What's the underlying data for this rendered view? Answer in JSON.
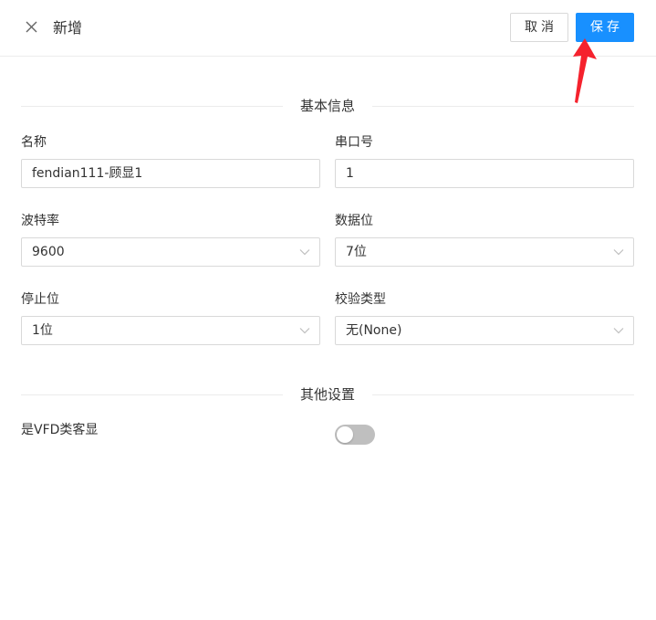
{
  "header": {
    "title": "新增",
    "cancel_label": "取消",
    "save_label": "保存"
  },
  "sections": {
    "basic": "基本信息",
    "other": "其他设置"
  },
  "fields": {
    "name": {
      "label": "名称",
      "value": "fendian111-顾显1"
    },
    "serial_port": {
      "label": "串口号",
      "value": "1"
    },
    "baud_rate": {
      "label": "波特率",
      "value": "9600"
    },
    "data_bits": {
      "label": "数据位",
      "value": "7位"
    },
    "stop_bits": {
      "label": "停止位",
      "value": "1位"
    },
    "parity": {
      "label": "校验类型",
      "value": "无(None)"
    },
    "vfd_display": {
      "label": "是VFD类客显",
      "enabled": false
    }
  },
  "colors": {
    "primary": "#1890ff",
    "annotation_arrow": "#f5222d",
    "toggle_off": "#bfbfbf"
  },
  "icons": {
    "close": "close-icon",
    "dropdown": "chevron-down-icon"
  }
}
